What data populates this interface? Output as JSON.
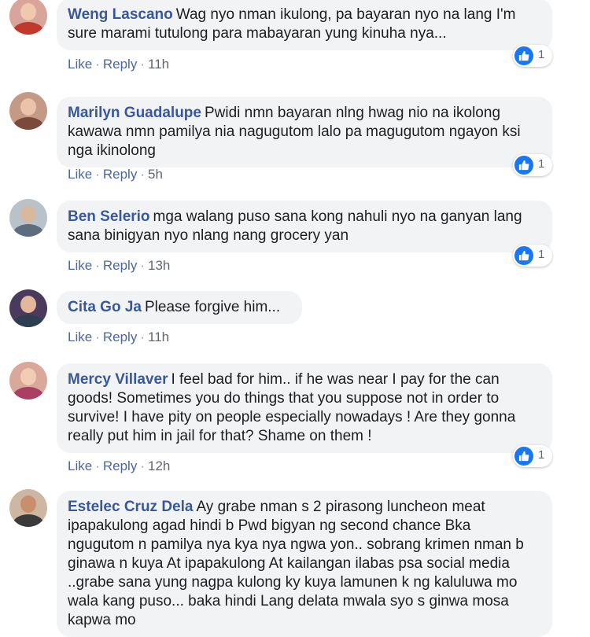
{
  "colors": {
    "name": "#385898",
    "link": "#4b67a1",
    "bubble": "#f2f3f5",
    "like": "#1877f2"
  },
  "comments": [
    {
      "name": "Weng Lascano",
      "text": "Wag nyo nman ikulong, pa bayaran nyo na lang I'm sure marami tutulong para mabayaran yung kinuha nya...",
      "like_label": "Like",
      "reply_label": "Reply",
      "time": "11h",
      "reaction_icon": "like-icon",
      "reactions": "1"
    },
    {
      "name": "Marilyn Guadalupe",
      "text": "Pwidi nmn bayaran nlng hwag nio na ikolong kawawa nmn pamilya nia nagugutom lalo pa magugutom ngayon ksi nga ikinolong",
      "like_label": "Like",
      "reply_label": "Reply",
      "time": "5h",
      "reaction_icon": "like-icon",
      "reactions": "1"
    },
    {
      "name": "Ben Selerio",
      "text": "mga walang puso sana kong nahuli nyo na ganyan lang sana binigyan nyo nlang nang grocery yan",
      "like_label": "Like",
      "reply_label": "Reply",
      "time": "13h",
      "reaction_icon": "like-icon",
      "reactions": "1"
    },
    {
      "name": "Cita Go Ja",
      "text": "Please forgive him...",
      "like_label": "Like",
      "reply_label": "Reply",
      "time": "11h"
    },
    {
      "name": "Mercy Villaver",
      "text": "I feel bad for him.. if he was near I pay for the can goods! Sometimes you do things that you suppose not in order to survive! I have pity on people especially nowadays ! Are they gonna really put him in jail for that? Shame on them !",
      "like_label": "Like",
      "reply_label": "Reply",
      "time": "12h",
      "reaction_icon": "like-icon",
      "reactions": "1"
    },
    {
      "name": "Estelec Cruz Dela",
      "text": "Ay grabe nman s 2 pirasong luncheon meat ipapakulong agad hindi b Pwd bigyan ng second chance Bka ngugutom n pamilya nya kya nya ngwa yon.. sobrang krimen nman b ginawa n kuya At ipapakulong At kailangan ilabas psa social media ..grabe sana yung nagpa kulong ky kuya lamunen k ng kaluluwa mo wala kang puso... baka hindi Lang delata mwala syo s ginwa mosa kapwa mo"
    }
  ]
}
